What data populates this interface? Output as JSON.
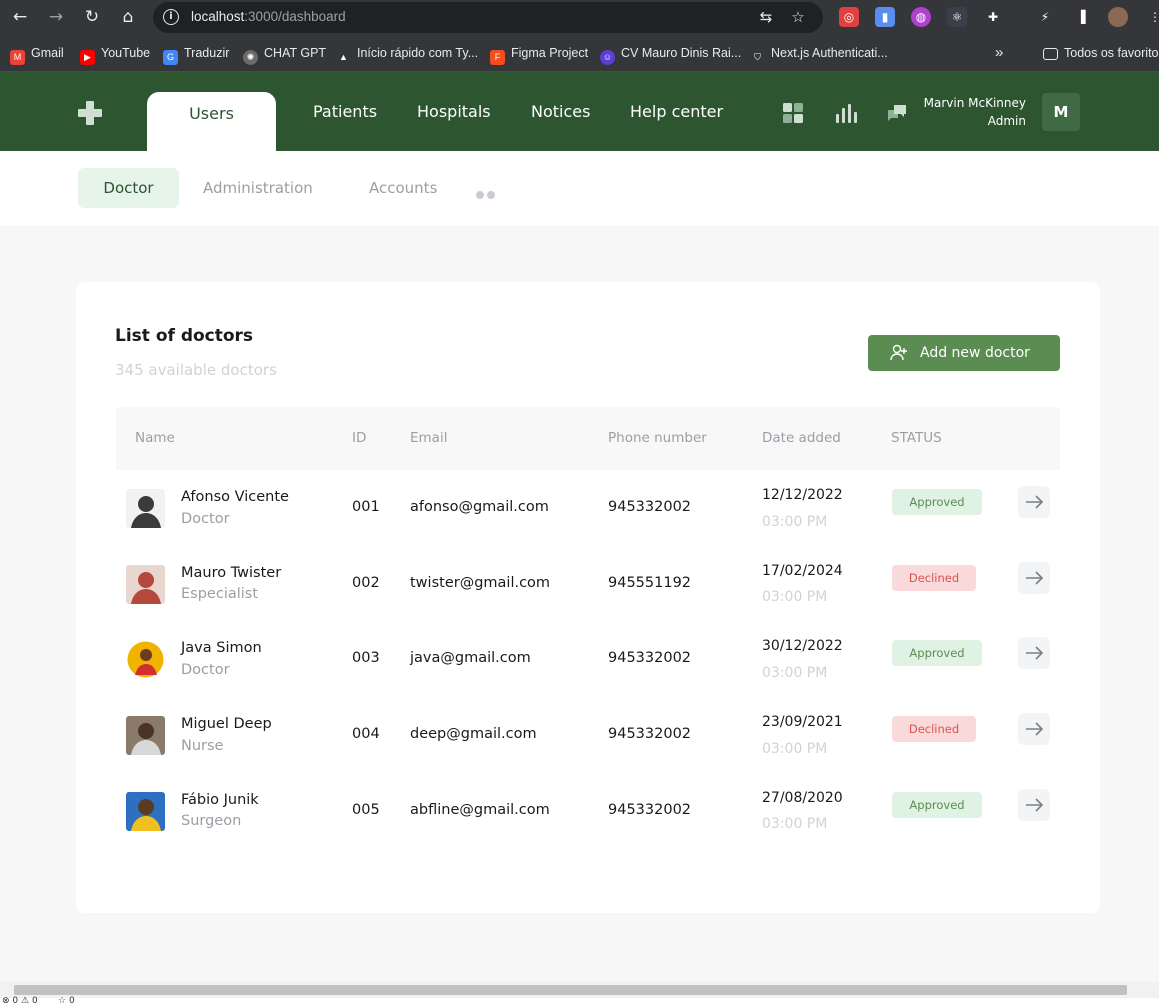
{
  "browser": {
    "url_host": "localhost",
    "url_path": ":3000/dashboard",
    "bookmarks": [
      {
        "label": "Gmail",
        "icon": "gmail-icon",
        "color": "#ea4335"
      },
      {
        "label": "YouTube",
        "icon": "youtube-icon",
        "color": "#ff0000"
      },
      {
        "label": "Traduzir",
        "icon": "translate-icon",
        "color": "#4285f4"
      },
      {
        "label": "CHAT GPT",
        "icon": "chatgpt-icon",
        "color": "#6b6b6b"
      },
      {
        "label": "Início rápido com Ty...",
        "icon": "typescript-icon",
        "color": "#6b6b6b"
      },
      {
        "label": "Figma Project",
        "icon": "figma-icon",
        "color": "#f24e1e"
      },
      {
        "label": "CV Mauro Dinis Rai...",
        "icon": "cv-icon",
        "color": "#5b3fd6"
      },
      {
        "label": "Next.js Authenticati...",
        "icon": "shield-icon",
        "color": "#444"
      }
    ],
    "more_label": "»",
    "all_bookmarks_label": "Todos os favoritos"
  },
  "header": {
    "tabs": [
      "Users",
      "Patients",
      "Hospitals",
      "Notices",
      "Help center"
    ],
    "active_tab": "Users",
    "user_name": "Marvin McKinney",
    "user_role": "Admin",
    "avatar_initial": "M",
    "brand_color": "#2c5530"
  },
  "subnav": {
    "tabs": [
      "Doctor",
      "Administration",
      "Accounts"
    ],
    "active": "Doctor"
  },
  "card": {
    "title": "List of doctors",
    "subtitle": "345 available doctors",
    "add_button_label": "Add new doctor",
    "columns": [
      "Name",
      "ID",
      "Email",
      "Phone number",
      "Date added",
      "STATUS"
    ],
    "rows": [
      {
        "name": "Afonso Vicente",
        "role": "Doctor",
        "id": "001",
        "email": "afonso@gmail.com",
        "phone": "945332002",
        "date": "12/12/2022",
        "time": "03:00 PM",
        "status": "Approved",
        "avatar_color": "#3b3b3b"
      },
      {
        "name": "Mauro Twister",
        "role": "Especialist",
        "id": "002",
        "email": "twister@gmail.com",
        "phone": "945551192",
        "date": "17/02/2024",
        "time": "03:00 PM",
        "status": "Declined",
        "avatar_color": "#b5473d"
      },
      {
        "name": "Java Simon",
        "role": "Doctor",
        "id": "003",
        "email": "java@gmail.com",
        "phone": "945332002",
        "date": "30/12/2022",
        "time": "03:00 PM",
        "status": "Approved",
        "avatar_color": "#f0b400"
      },
      {
        "name": "Miguel Deep",
        "role": "Nurse",
        "id": "004",
        "email": "deep@gmail.com",
        "phone": "945332002",
        "date": "23/09/2021",
        "time": "03:00 PM",
        "status": "Declined",
        "avatar_color": "#6e5a4a"
      },
      {
        "name": "Fábio Junik",
        "role": "Surgeon",
        "id": "005",
        "email": "abfline@gmail.com",
        "phone": "945332002",
        "date": "27/08/2020",
        "time": "03:00 PM",
        "status": "Approved",
        "avatar_color": "#2d6fc0"
      }
    ]
  },
  "status_bar": {
    "errors": "0",
    "warnings": "0",
    "info": "0"
  }
}
